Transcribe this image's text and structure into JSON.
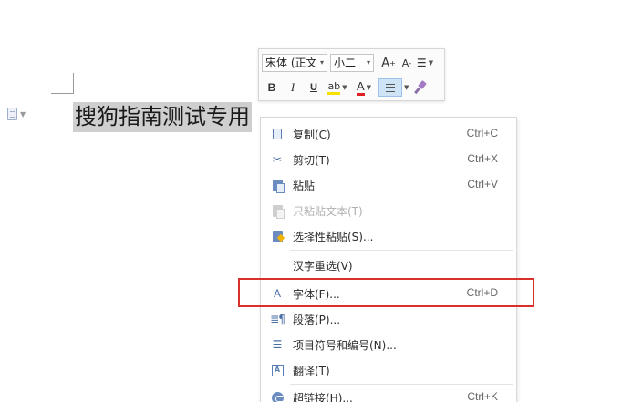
{
  "document": {
    "selected_text": "搜狗指南测试专用"
  },
  "mini_toolbar": {
    "font_name": "宋体 (正文",
    "font_size": "小二",
    "grow_font_label": "A",
    "shrink_font_label": "A",
    "bold_label": "B",
    "italic_label": "I",
    "underline_label": "U",
    "highlight_label": "ab",
    "font_color_label": "A",
    "highlight_color": "#f5e000",
    "font_color": "#e02020"
  },
  "context_menu": {
    "items": [
      {
        "label": "复制(C)",
        "shortcut": "Ctrl+C",
        "icon": "copy-icon",
        "enabled": true
      },
      {
        "label": "剪切(T)",
        "shortcut": "Ctrl+X",
        "icon": "scissors-icon",
        "enabled": true
      },
      {
        "label": "粘贴",
        "shortcut": "Ctrl+V",
        "icon": "paste-icon",
        "enabled": true
      },
      {
        "label": "只粘贴文本(T)",
        "shortcut": "",
        "icon": "paste-text-icon",
        "enabled": false
      },
      {
        "label": "选择性粘贴(S)...",
        "shortcut": "",
        "icon": "paste-special-icon",
        "enabled": true
      },
      {
        "label": "汉字重选(V)",
        "shortcut": "",
        "icon": "",
        "enabled": true
      },
      {
        "label": "字体(F)...",
        "shortcut": "Ctrl+D",
        "icon": "font-icon",
        "enabled": true,
        "highlighted": true
      },
      {
        "label": "段落(P)...",
        "shortcut": "",
        "icon": "paragraph-icon",
        "enabled": true
      },
      {
        "label": "项目符号和编号(N)...",
        "shortcut": "",
        "icon": "bullet-list-icon",
        "enabled": true
      },
      {
        "label": "翻译(T)",
        "shortcut": "",
        "icon": "translate-icon",
        "enabled": true
      },
      {
        "label": "超链接(H)...",
        "shortcut": "Ctrl+K",
        "icon": "hyperlink-icon",
        "enabled": true
      }
    ]
  },
  "colors": {
    "annotation_red": "#d9302a",
    "selection_gray": "#cfcfcf",
    "toolbar_active_blue": "#cfe3f7"
  }
}
